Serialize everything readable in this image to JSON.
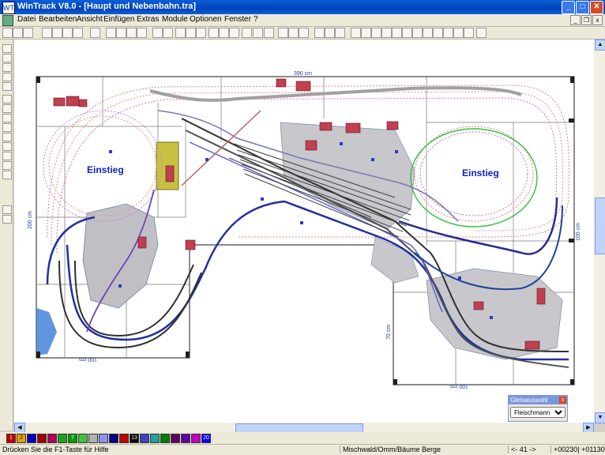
{
  "window": {
    "title": "WinTrack  V8.0 - [Haupt und Nebenbahn.tra]",
    "app_icon": "WT"
  },
  "menu": [
    "Datei",
    "Bearbeiten",
    "Ansicht",
    "Einfügen",
    "Extras",
    "Module",
    "Optionen",
    "Fenster",
    "?"
  ],
  "plan": {
    "zone_left": "Einstieg",
    "zone_right": "Einstieg",
    "dim_top": "390 cm",
    "dim_left": "200 cm",
    "dim_right": "100 cm",
    "dim_bottom_left": "100 cm",
    "dim_bottom_right": "100 cm",
    "dim_inner_right": "70 cm"
  },
  "gleisauswahl": {
    "title": "Gleisauswahl",
    "selected": "Fleischmann pi"
  },
  "colors": [
    "#c00000",
    "#e8a000",
    "#0000c0",
    "#a00000",
    "#b00060",
    "#20a020",
    "#00a000",
    "#40c040",
    "#b0b0b0",
    "#9090ff",
    "#000080",
    "#c00000",
    "#000000",
    "#4040c0",
    "#20a0a0",
    "#008000",
    "#600060",
    "#6000a0",
    "#c000c0",
    "#0000ff"
  ],
  "color_labels": [
    "1",
    "2",
    "",
    "",
    "",
    "",
    "7",
    "",
    "",
    "",
    "",
    "",
    "13",
    "",
    "",
    "",
    "",
    "",
    "",
    "20"
  ],
  "status": {
    "help": "Drücken Sie die  F1-Taste für Hilfe",
    "layer": "Mischwald/Omm/Bäume Berge",
    "pos": "<- 41 ->",
    "coords": "+00230| +01130"
  },
  "accent": "#0a5fd8"
}
